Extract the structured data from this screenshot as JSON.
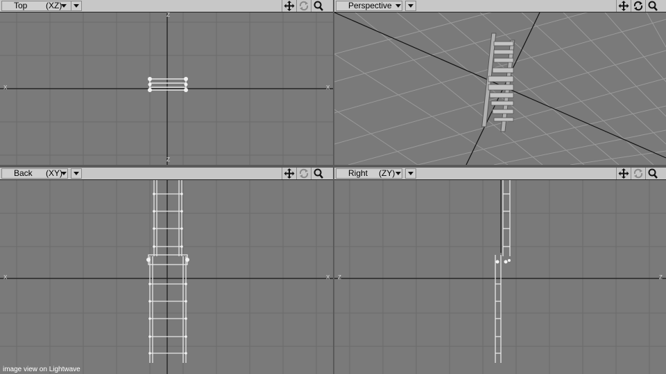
{
  "viewports": [
    {
      "name": "Top",
      "axis": "(XZ)"
    },
    {
      "name": "Perspective",
      "axis": ""
    },
    {
      "name": "Back",
      "axis": "(XY)"
    },
    {
      "name": "Right",
      "axis": "(ZY)"
    }
  ],
  "axis_markers": {
    "top": {
      "up": "Z",
      "down": "Z",
      "left": "X",
      "right": "X"
    },
    "back": {
      "left": "X",
      "right": "X"
    },
    "right": {
      "left": "Z",
      "right": "Z"
    }
  },
  "icons": {
    "move": "move-view-icon",
    "rotate": "rotate-view-icon",
    "zoom": "zoom-view-icon",
    "view_menu": "chevron-down-icon"
  },
  "colors": {
    "header_bg": "#c7c7c7",
    "viewport_bg": "#7a7a7a",
    "grid_line": "#6a6a6a",
    "axis_line": "#1a1a1a",
    "wireframe": "#e8e8e8"
  },
  "caption": "image view on Lightwave"
}
